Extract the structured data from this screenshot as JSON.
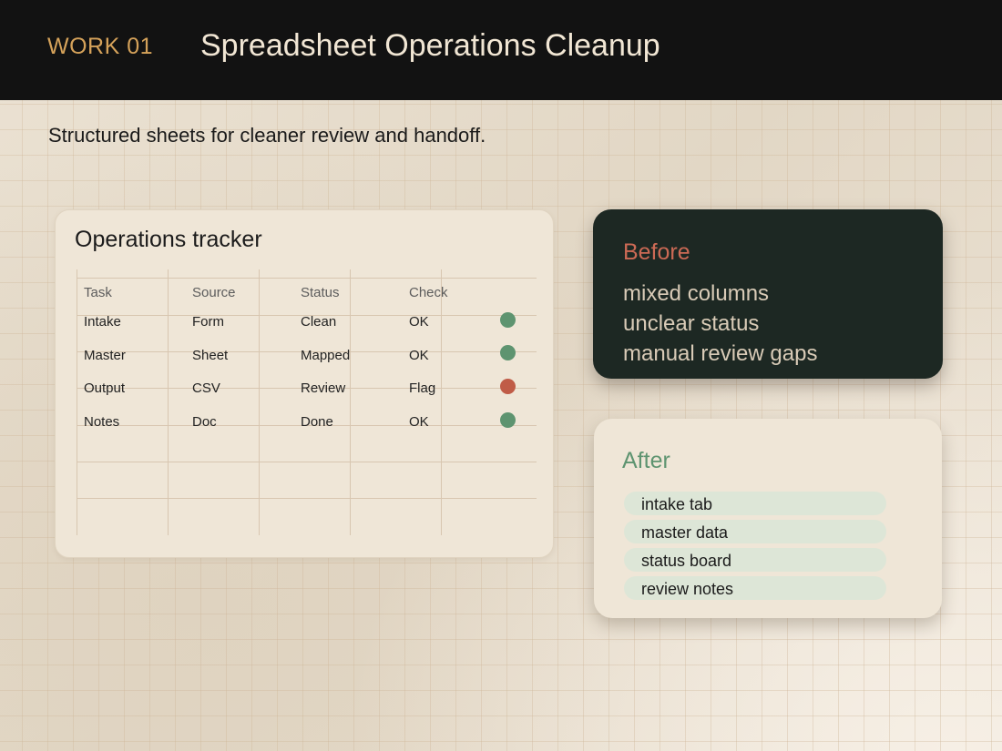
{
  "header": {
    "tag": "WORK 01",
    "title": "Spreadsheet Operations Cleanup"
  },
  "subtitle": "Structured sheets for cleaner review and handoff.",
  "tracker": {
    "title": "Operations tracker",
    "columns": [
      "Task",
      "Source",
      "Status",
      "Check"
    ],
    "rows": [
      {
        "task": "Intake",
        "source": "Form",
        "status": "Clean",
        "check": "OK",
        "indicator": "#5e9470"
      },
      {
        "task": "Master",
        "source": "Sheet",
        "status": "Mapped",
        "check": "OK",
        "indicator": "#5e9470"
      },
      {
        "task": "Output",
        "source": "CSV",
        "status": "Review",
        "check": "Flag",
        "indicator": "#c05c47"
      },
      {
        "task": "Notes",
        "source": "Doc",
        "status": "Done",
        "check": "OK",
        "indicator": "#5e9470"
      }
    ]
  },
  "before": {
    "title": "Before",
    "items": [
      "mixed columns",
      "unclear status",
      "manual review gaps"
    ]
  },
  "after": {
    "title": "After",
    "items": [
      "intake tab",
      "master data",
      "status board",
      "review notes"
    ]
  },
  "colors": {
    "accent_gold": "#d5a25a",
    "ok_green": "#5e9470",
    "flag_red": "#c05c47",
    "dark_card": "#1d2823"
  }
}
